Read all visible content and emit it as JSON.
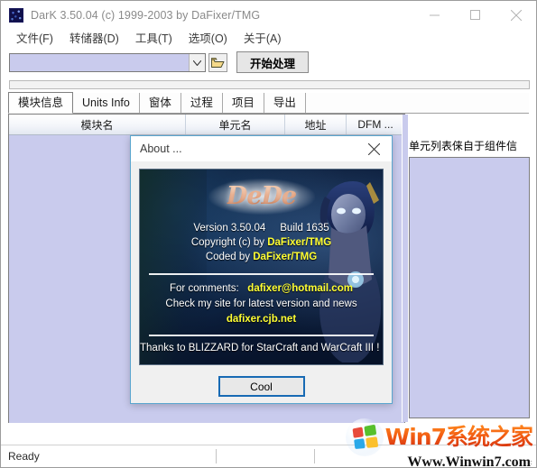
{
  "window": {
    "title": "DarK 3.50.04 (c) 1999-2003 by DaFixer/TMG",
    "icon": "app-icon",
    "minimize": "minimize-icon",
    "maximize": "maximize-icon",
    "close": "close-icon"
  },
  "menu": {
    "items": [
      {
        "label": "文件(F)"
      },
      {
        "label": "转储器(D)"
      },
      {
        "label": "工具(T)"
      },
      {
        "label": "选项(O)"
      },
      {
        "label": "关于(A)"
      }
    ]
  },
  "toolbar": {
    "combo_value": "",
    "combo_placeholder": "",
    "dropdown_icon": "chevron-down-icon",
    "browse_icon": "folder-open-icon",
    "process_label": "开始处理"
  },
  "tabs": [
    {
      "label": "模块信息",
      "selected": true
    },
    {
      "label": "Units Info",
      "selected": false
    },
    {
      "label": "窗体",
      "selected": false
    },
    {
      "label": "过程",
      "selected": false
    },
    {
      "label": "项目",
      "selected": false
    },
    {
      "label": "导出",
      "selected": false
    }
  ],
  "table": {
    "columns": [
      {
        "label": "模块名",
        "width": 196
      },
      {
        "label": "单元名",
        "width": 110
      },
      {
        "label": "地址",
        "width": 68
      },
      {
        "label": "DFM ...",
        "width": 64
      }
    ],
    "rows": []
  },
  "right_panel": {
    "label": "单元列表俫自于组件信"
  },
  "statusbar": {
    "ready": "Ready",
    "cell2": "",
    "cell3": ""
  },
  "about": {
    "title": "About ...",
    "close_icon": "close-icon",
    "logo": "DeDe",
    "version": "Version 3.50.04",
    "build": "Build 1635",
    "copyright_prefix": "Copyright (c) by",
    "copyright_author": "DaFixer/TMG",
    "coded_prefix": "Coded by",
    "coded_author": "DaFixer/TMG",
    "comments_prefix": "For comments:",
    "comments_email": "dafixer@hotmail.com",
    "site_line": "Check my site for latest version and news",
    "site_url": "dafixer.cjb.net",
    "thanks": "Thanks to BLIZZARD for StarCraft and WarCraft III ! ;-)",
    "ok_label": "Cool"
  },
  "watermark": {
    "brand": "Win7系统之家",
    "url": "Www.Winwin7.com",
    "logo": "windows-orb-icon"
  },
  "colors": {
    "list_lavender": "#c9cbed",
    "accent_blue": "#186ab4",
    "highlight_yellow": "#ffff33",
    "dialog_border": "#5aa6cf"
  }
}
